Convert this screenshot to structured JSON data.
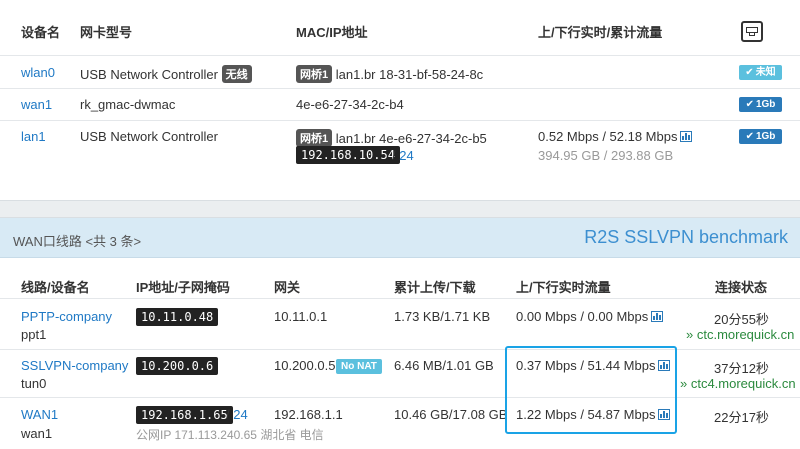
{
  "devices": {
    "headers": [
      "设备名",
      "网卡型号",
      "MAC/IP地址",
      "上/下行实时/累计流量"
    ],
    "header_icon": "ethernet-port-icon",
    "rows": [
      {
        "name": "wlan0",
        "model": "USB Network Controller",
        "model_badge": "无线",
        "bridge": "网桥1",
        "mac": "lan1.br 18-31-bf-58-24-8c",
        "ip": "",
        "ip_suffix": "",
        "rate": "",
        "total": "",
        "speed": "未知",
        "speed_state": "light"
      },
      {
        "name": "wan1",
        "model": "rk_gmac-dwmac",
        "model_badge": "",
        "bridge": "",
        "mac": "4e-e6-27-34-2c-b4",
        "ip": "",
        "ip_suffix": "",
        "rate": "",
        "total": "",
        "speed": "1Gb",
        "speed_state": "dark"
      },
      {
        "name": "lan1",
        "model": "USB Network Controller",
        "model_badge": "",
        "bridge": "网桥1",
        "mac": "lan1.br 4e-e6-27-34-2c-b5",
        "ip": "192.168.10.54",
        "ip_suffix": "24",
        "rate": "0.52 Mbps / 52.18 Mbps",
        "total": "394.95 GB / 293.88 GB",
        "speed": "1Gb",
        "speed_state": "dark"
      }
    ]
  },
  "wan": {
    "title": "WAN口线路 <共 3 条>",
    "benchmark": "R2S SSLVPN benchmark",
    "headers": [
      "线路/设备名",
      "IP地址/子网掩码",
      "网关",
      "累计上传/下载",
      "上/下行实时流量",
      "连接状态"
    ],
    "rows": [
      {
        "name": "PPTP-company",
        "dev": "ppt1",
        "ip": "10.11.0.48",
        "ip_suffix": "",
        "nonat": "",
        "public_ip": "",
        "gateway": "10.11.0.1",
        "total": "1.73 KB/1.71 KB",
        "rate": "0.00 Mbps / 0.00 Mbps",
        "uptime": "20分55秒",
        "host": "» ctc.morequick.cn"
      },
      {
        "name": "SSLVPN-company",
        "dev": "tun0",
        "ip": "10.200.0.6",
        "ip_suffix": "",
        "nonat": "No NAT",
        "public_ip": "",
        "gateway": "10.200.0.5",
        "total": "6.46 MB/1.01 GB",
        "rate": "0.37 Mbps / 51.44 Mbps",
        "uptime": "37分12秒",
        "host": "» ctc4.morequick.cn"
      },
      {
        "name": "WAN1",
        "dev": "wan1",
        "ip": "192.168.1.65",
        "ip_suffix": "24",
        "nonat": "",
        "public_ip": "公网IP 171.113.240.65  湖北省 电信",
        "gateway": "192.168.1.1",
        "total": "10.46 GB/17.08 GB",
        "rate": "1.22 Mbps / 54.87 Mbps",
        "uptime": "22分17秒",
        "host": ""
      }
    ]
  }
}
